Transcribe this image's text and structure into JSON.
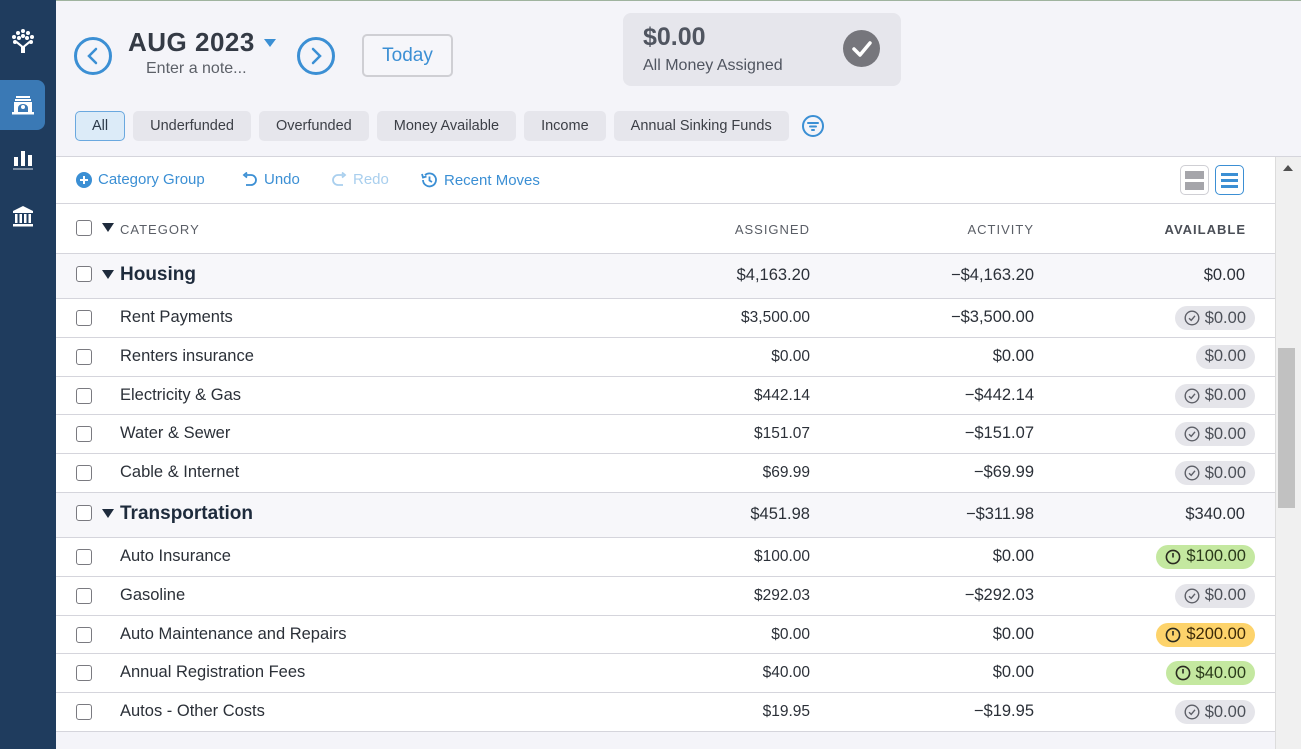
{
  "sidebar": {
    "items": [
      {
        "icon": "tree-logo-icon",
        "active": false
      },
      {
        "icon": "budget-icon",
        "active": true
      },
      {
        "icon": "reports-icon",
        "active": false
      },
      {
        "icon": "accounts-bank-icon",
        "active": false
      }
    ]
  },
  "header": {
    "month": "AUG 2023",
    "note_placeholder": "Enter a note...",
    "today_label": "Today",
    "ready_to_assign": {
      "amount": "$0.00",
      "label": "All Money Assigned"
    },
    "filters": [
      {
        "label": "All",
        "active": true
      },
      {
        "label": "Underfunded",
        "active": false
      },
      {
        "label": "Overfunded",
        "active": false
      },
      {
        "label": "Money Available",
        "active": false
      },
      {
        "label": "Income",
        "active": false
      },
      {
        "label": "Annual Sinking Funds",
        "active": false
      }
    ]
  },
  "toolbar": {
    "category_group": "Category Group",
    "undo": "Undo",
    "redo": "Redo",
    "recent_moves": "Recent Moves"
  },
  "table": {
    "columns": {
      "category": "CATEGORY",
      "assigned": "ASSIGNED",
      "activity": "ACTIVITY",
      "available": "AVAILABLE"
    },
    "groups": [
      {
        "name": "Housing",
        "assigned": "$4,163.20",
        "activity": "−$4,163.20",
        "available": "$0.00",
        "items": [
          {
            "name": "Rent Payments",
            "assigned": "$3,500.00",
            "activity": "−$3,500.00",
            "available": "$0.00",
            "status": "funded"
          },
          {
            "name": "Renters insurance",
            "assigned": "$0.00",
            "activity": "$0.00",
            "available": "$0.00",
            "status": "none"
          },
          {
            "name": "Electricity & Gas",
            "assigned": "$442.14",
            "activity": "−$442.14",
            "available": "$0.00",
            "status": "funded"
          },
          {
            "name": "Water & Sewer",
            "assigned": "$151.07",
            "activity": "−$151.07",
            "available": "$0.00",
            "status": "funded"
          },
          {
            "name": "Cable & Internet",
            "assigned": "$69.99",
            "activity": "−$69.99",
            "available": "$0.00",
            "status": "funded"
          }
        ]
      },
      {
        "name": "Transportation",
        "assigned": "$451.98",
        "activity": "−$311.98",
        "available": "$340.00",
        "items": [
          {
            "name": "Auto Insurance",
            "assigned": "$100.00",
            "activity": "$0.00",
            "available": "$100.00",
            "status": "available"
          },
          {
            "name": "Gasoline",
            "assigned": "$292.03",
            "activity": "−$292.03",
            "available": "$0.00",
            "status": "funded"
          },
          {
            "name": "Auto Maintenance and Repairs",
            "assigned": "$0.00",
            "activity": "$0.00",
            "available": "$200.00",
            "status": "underfunded"
          },
          {
            "name": "Annual Registration Fees",
            "assigned": "$40.00",
            "activity": "$0.00",
            "available": "$40.00",
            "status": "available"
          },
          {
            "name": "Autos - Other Costs",
            "assigned": "$19.95",
            "activity": "−$19.95",
            "available": "$0.00",
            "status": "funded"
          }
        ]
      }
    ]
  },
  "colors": {
    "sidebar_bg": "#1f3c5e",
    "accent": "#3b8fd4",
    "available_pill": "#c4e8a0",
    "underfunded_pill": "#fdd36b",
    "funded_pill": "#e5e5ea"
  }
}
